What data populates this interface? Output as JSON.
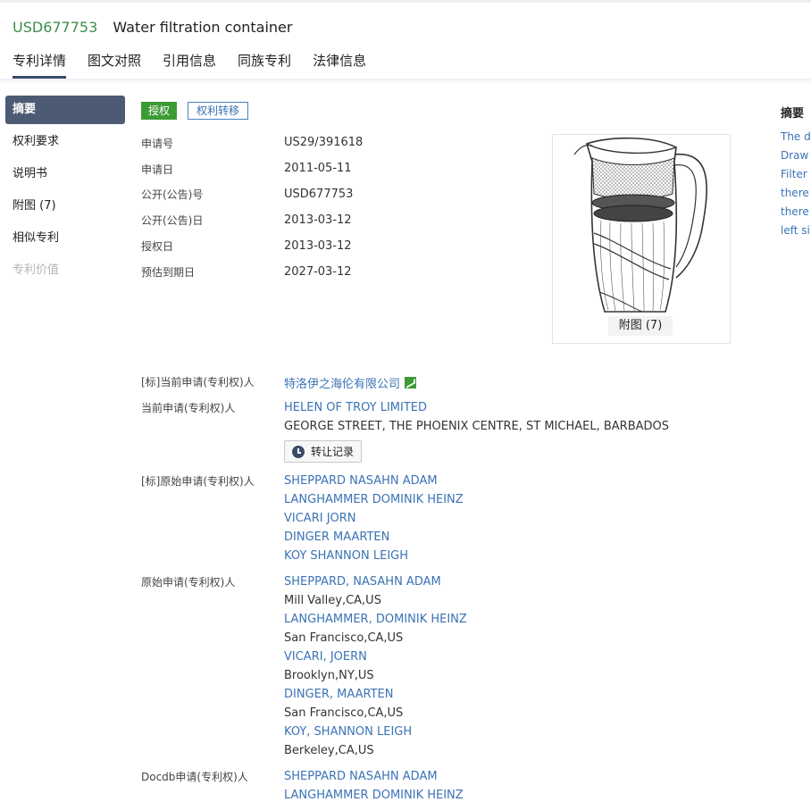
{
  "header": {
    "patent_number": "USD677753",
    "title": "Water filtration container"
  },
  "tabs": [
    "专利详情",
    "图文对照",
    "引用信息",
    "同族专利",
    "法律信息"
  ],
  "sidebar": {
    "items": [
      {
        "label": "摘要"
      },
      {
        "label": "权利要求"
      },
      {
        "label": "说明书"
      },
      {
        "label": "附图 (7)"
      },
      {
        "label": "相似专利"
      },
      {
        "label": "专利价值"
      }
    ]
  },
  "status": {
    "granted": "授权",
    "transfer": "权利转移"
  },
  "fields": {
    "app_no_label": "申请号",
    "app_no": "US29/391618",
    "app_date_label": "申请日",
    "app_date": "2011-05-11",
    "pub_no_label": "公开(公告)号",
    "pub_no": "USD677753",
    "pub_date_label": "公开(公告)日",
    "pub_date": "2013-03-12",
    "grant_date_label": "授权日",
    "grant_date": "2013-03-12",
    "expiry_label": "预估到期日",
    "expiry": "2027-03-12"
  },
  "figure": {
    "caption": "附图 (7)"
  },
  "abstract": {
    "title": "摘要",
    "lines": [
      "The d",
      "Draw",
      "Filter",
      "there",
      "there",
      "left si"
    ]
  },
  "applicants": {
    "std_current_label": "[标]当前申请(专利权)人",
    "std_current": "特洛伊之海伦有限公司",
    "current_label": "当前申请(专利权)人",
    "current_name": "HELEN OF TROY LIMITED",
    "current_address": "GEORGE STREET, THE PHOENIX CENTRE, ST MICHAEL, BARBADOS",
    "transfer_button": "转让记录",
    "std_original_label": "[标]原始申请(专利权)人",
    "std_original": [
      "SHEPPARD NASAHN ADAM",
      "LANGHAMMER DOMINIK HEINZ",
      "VICARI JORN",
      "DINGER MAARTEN",
      "KOY SHANNON LEIGH"
    ],
    "original_label": "原始申请(专利权)人",
    "original": [
      {
        "name": "SHEPPARD, NASAHN ADAM",
        "loc": "Mill Valley,CA,US"
      },
      {
        "name": "LANGHAMMER, DOMINIK HEINZ",
        "loc": "San Francisco,CA,US"
      },
      {
        "name": "VICARI, JOERN",
        "loc": "Brooklyn,NY,US"
      },
      {
        "name": "DINGER, MAARTEN",
        "loc": "San Francisco,CA,US"
      },
      {
        "name": "KOY, SHANNON LEIGH",
        "loc": "Berkeley,CA,US"
      }
    ],
    "docdb_label": "Docdb申请(专利权)人",
    "docdb": [
      "SHEPPARD NASAHN ADAM",
      "LANGHAMMER DOMINIK HEINZ"
    ]
  }
}
